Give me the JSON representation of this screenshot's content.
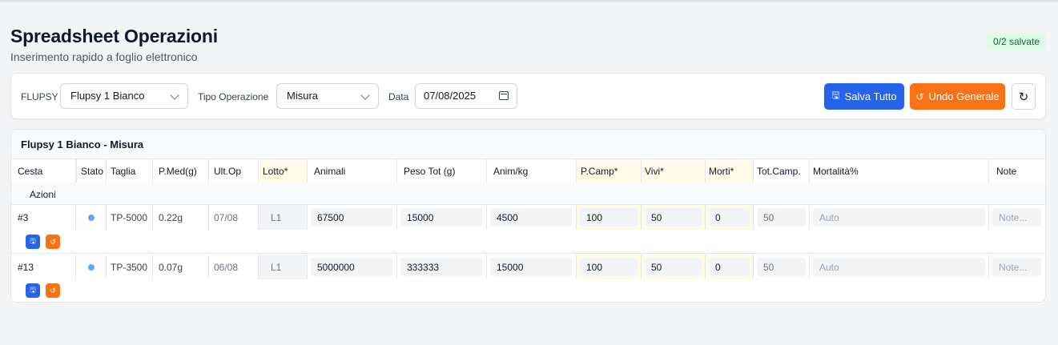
{
  "page": {
    "title": "Spreadsheet Operazioni",
    "subtitle": "Inserimento rapido a foglio elettronico",
    "badge": "0/2 salvate"
  },
  "toolbar": {
    "flupsy_label": "FLUPSY",
    "flupsy_value": "Flupsy 1 Bianco",
    "tipo_label": "Tipo Operazione",
    "tipo_value": "Misura",
    "data_label": "Data",
    "data_value": "07/08/2025",
    "save_all": "Salva Tutto",
    "undo_all": "Undo Generale",
    "refresh_icon": "refresh-icon"
  },
  "table": {
    "title": "Flupsy 1 Bianco - Misura",
    "headers": {
      "cesta": "Cesta",
      "stato": "Stato",
      "taglia": "Taglia",
      "pmed": "P.Med(g)",
      "ultop": "Ult.Op",
      "lotto": "Lotto*",
      "animali": "Animali",
      "pesotot": "Peso Tot (g)",
      "animkg": "Anim/kg",
      "pcamp": "P.Camp*",
      "vivi": "Vivi*",
      "morti": "Morti*",
      "totcamp": "Tot.Camp.",
      "mortalita": "Mortalità%",
      "note": "Note",
      "azioni": "Azioni"
    },
    "rows": [
      {
        "cesta": "#3",
        "taglia": "TP-5000",
        "pmed": "0.22g",
        "ultop": "07/08",
        "lotto": "L1",
        "animali": "67500",
        "pesotot": "15000",
        "animkg": "4500",
        "pcamp": "100",
        "vivi": "50",
        "morti": "0",
        "totcamp": "50",
        "mortalita": "Auto",
        "note": "Note..."
      },
      {
        "cesta": "#13",
        "taglia": "TP-3500",
        "pmed": "0.07g",
        "ultop": "06/08",
        "lotto": "L1",
        "animali": "5000000",
        "pesotot": "333333",
        "animkg": "15000",
        "pcamp": "100",
        "vivi": "50",
        "morti": "0",
        "totcamp": "50",
        "mortalita": "Auto",
        "note": "Note..."
      }
    ]
  },
  "colors": {
    "primary": "#2563eb",
    "accent": "#f97316",
    "highlight": "#fefce8",
    "status_dot": "#60a5fa"
  }
}
